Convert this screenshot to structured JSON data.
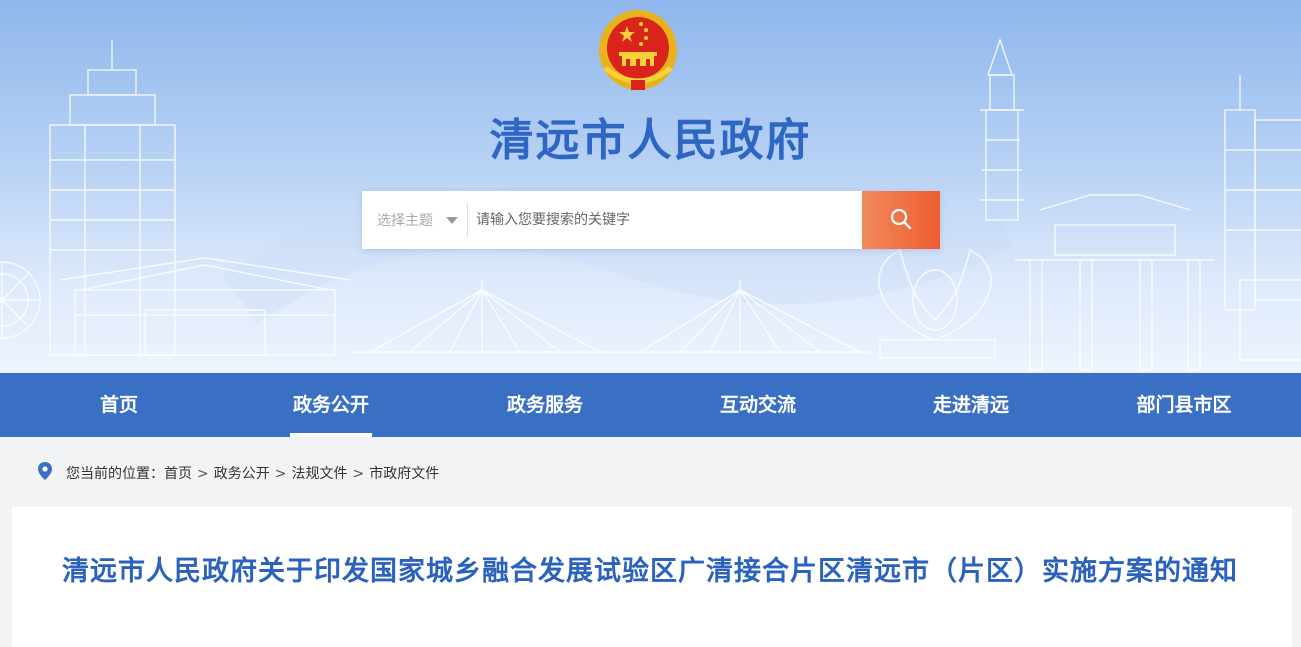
{
  "site": {
    "title": "清远市人民政府"
  },
  "search": {
    "topic_label": "选择主题",
    "placeholder": "请输入您要搜索的关键字",
    "button_icon": "search-icon"
  },
  "nav": {
    "items": [
      {
        "label": "首页",
        "active": false
      },
      {
        "label": "政务公开",
        "active": true
      },
      {
        "label": "政务服务",
        "active": false
      },
      {
        "label": "互动交流",
        "active": false
      },
      {
        "label": "走进清远",
        "active": false
      },
      {
        "label": "部门县市区",
        "active": false
      }
    ]
  },
  "breadcrumb": {
    "prefix": "您当前的位置：",
    "items": [
      "首页",
      "政务公开",
      "法规文件",
      "市政府文件"
    ],
    "separator": ">"
  },
  "article": {
    "title": "清远市人民政府关于印发国家城乡融合发展试验区广清接合片区清远市（片区）实施方案的通知"
  },
  "colors": {
    "brand_blue": "#3a70c4",
    "title_blue": "#2d66c4",
    "search_orange": "#ee5c2f"
  }
}
